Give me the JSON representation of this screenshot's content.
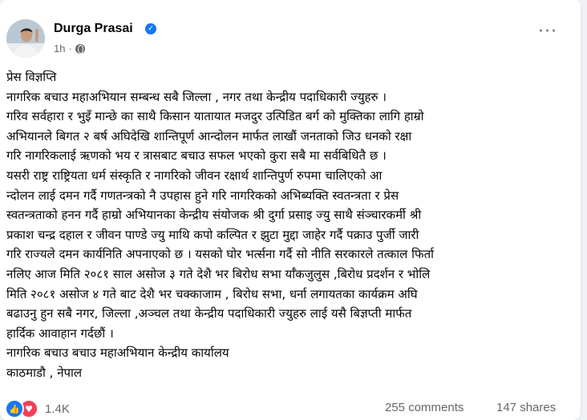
{
  "post": {
    "author": "Durga Prasai",
    "time": "1h",
    "separator": "·",
    "verified_icon": "verified-badge-icon",
    "audience_icon": "globe-icon",
    "more_icon": "more-options-icon",
    "lines": [
      "प्रेस विज्ञप्ति",
      "नागरिक बचाउ महाअभियान सम्बन्ध सबै जिल्ला , नगर तथा केन्द्रीय पदाधिकारी ज्युहरु ।",
      "गरिव सर्वहारा र भुइँ मान्छे का साथै  किसान यातायात मजदुर उत्पिडित बर्ग को मुक्तिका लागि हाम्रो",
      "अभियानले बिगत २ बर्ष अघिदेखि शान्तिपूर्ण आन्दोलन मार्फत लाखौं जनताको जिउ धनको रक्षा",
      "गरि नागरिकलाई ऋणको भय र त्रासबाट बचाउ सफल भएको कुरा सबै मा सर्वबिधितै छ ।",
      "    यसरी राष्ट्र राष्ट्रियता धर्म संस्कृति र नागरिको जीवन रक्षार्थ शान्तिपुर्ण रुपमा चालिएको आ",
      "न्दोलन लाई दमन गर्दै गणतन्त्रको नै उपहास हुने गरि नागरिकको अभिब्यक्ति स्वतन्त्रता र प्रेस",
      "स्वतन्त्रताको  हनन गर्दै हाम्रो अभियानका केन्द्रीय संयोजक श्री दुर्गा प्रसाइ ज्यु  साथै संञ्चारकर्मी श्री",
      "प्रकाश चन्द्र दहाल र जीवन पाण्डे ज्यु माथि कपो कल्पित र झुटा मुद्दा जाहेर गर्दै  पक्राउ पुर्जी जारी",
      "गरि राज्यले दमन कार्यनिति अपनाएको छ । यसको घोर भर्त्सना गर्दै सो नीति सरकारले तत्काल फिर्ता",
      "नलिए आज मिति २०८१ साल असोज ३ गते  देशै भर बिरोध सभा र्याँकजुलुस ,बिरोध प्रदर्शन र भोलि",
      "मिति २०८१ असोज ४ गते बाट देशै भर चक्काजाम , बिरोध सभा, धर्ना लगायतका कार्यक्रम अघि",
      "बढाउनु हुन सबै नगर, जिल्ला ,अञ्चल तथा केन्द्रीय पदाधिकारी ज्युहरु लाई  यसै बिज्ञप्ती मार्फत",
      "हार्दिक आवाहान  गर्दछौं  ।",
      "             नागरिक बचाउ बचाउ महाअभियान केन्द्रीय कार्यालय",
      "          काठमाडौ , नेपाल"
    ]
  },
  "footer": {
    "like_icon": "like-reaction-icon",
    "love_icon": "love-reaction-icon",
    "reaction_count": "1.4K",
    "comments": "255 comments",
    "shares": "147 shares"
  },
  "colors": {
    "accent": "#1877f2",
    "love": "#f33e58",
    "secondary_text": "#65676b",
    "primary_text": "#050505"
  }
}
